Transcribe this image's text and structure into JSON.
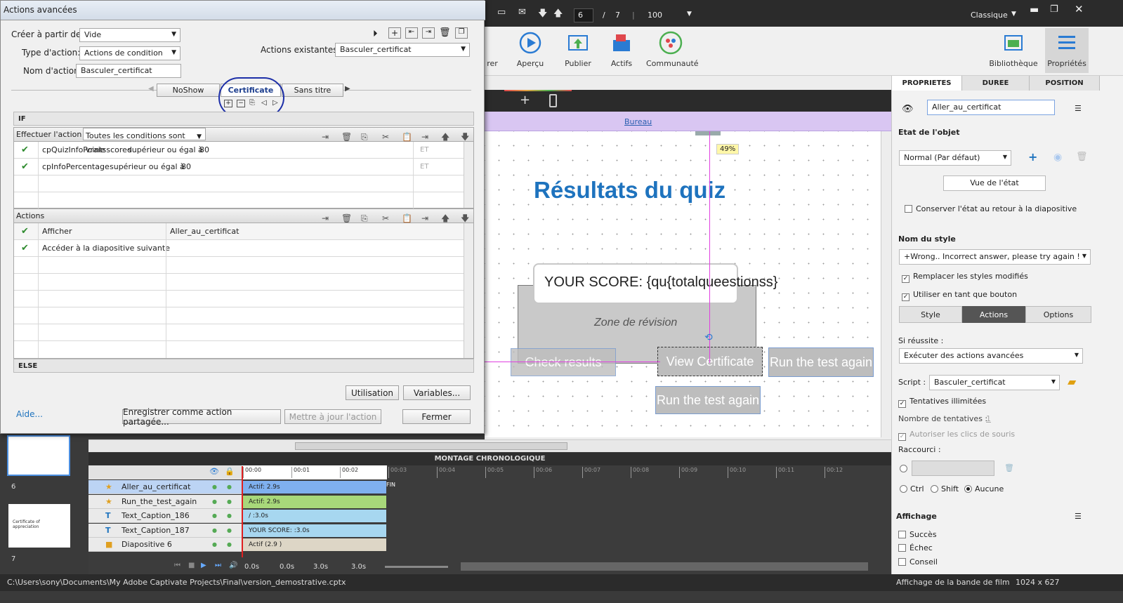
{
  "toolbar": {
    "slide_current": "6",
    "slide_sep": "/",
    "slide_total": "7",
    "zoom": "100",
    "workspace": "Classique"
  },
  "ribbon": {
    "buttons": [
      {
        "label": "rer",
        "icon": "record-icon"
      },
      {
        "label": "Aperçu",
        "icon": "play-icon"
      },
      {
        "label": "Publier",
        "icon": "publish-icon"
      },
      {
        "label": "Actifs",
        "icon": "assets-icon"
      },
      {
        "label": "Communauté",
        "icon": "community-icon"
      },
      {
        "label": "Bibliothèque",
        "icon": "library-icon"
      },
      {
        "label": "Propriétés",
        "icon": "properties-icon"
      }
    ]
  },
  "stage": {
    "breadcrumb": "Bureau",
    "progress_badge": "49%",
    "slide_title": "Résultats du quiz",
    "score_text": "YOUR   SCORE: {qu{totalqueestionss}",
    "review_zone": "Zone de révision",
    "btn_check": "Check results",
    "btn_view": "View Certificate",
    "btn_run1": "Run the test again",
    "btn_run2": "Run the test again"
  },
  "props": {
    "tabs": [
      "PROPRIETES",
      "DUREE",
      "POSITION"
    ],
    "object_name": "Aller_au_certificat",
    "state_title": "Etat de l'objet",
    "state_value": "Normal (Par défaut)",
    "state_view_btn": "Vue de l'état",
    "keep_state": "Conserver l'état au retour à la diapositive",
    "style_title": "Nom du style",
    "style_value": "+Wrong.. Incorrect answer, please try again !",
    "replace_styles": "Remplacer les styles modifiés",
    "use_as_button": "Utiliser en tant que bouton",
    "subtabs": [
      "Style",
      "Actions",
      "Options"
    ],
    "on_success": "Si réussite :",
    "on_success_value": "Exécuter des actions avancées",
    "script_label": "Script :",
    "script_value": "Basculer_certificat",
    "unlimited": "Tentatives illimitées",
    "attempts_label": "Nombre de tentatives :",
    "attempts_value": "1",
    "allow_clicks": "Autoriser les clics de souris",
    "shortcut_label": "Raccourci :",
    "ctrl": "Ctrl",
    "shift": "Shift",
    "none": "Aucune",
    "display_title": "Affichage",
    "success": "Succès",
    "fail": "Échec",
    "hint": "Conseil"
  },
  "timeline": {
    "title": "MONTAGE CHRONOLOGIQUE",
    "ticks": [
      "00:00",
      "00:01",
      "00:02",
      "00:03",
      "00:04",
      "00:05",
      "00:06",
      "00:07",
      "00:08",
      "00:09",
      "00:10",
      "00:11",
      "00:12"
    ],
    "rows": [
      {
        "name": "Aller_au_certificat",
        "bar": "Actif: 2.9s",
        "color": "#7fb0ef",
        "icon": "star-icon"
      },
      {
        "name": "Run_the_test_again",
        "bar": "Actif: 2.9s",
        "color": "#a8d87a",
        "icon": "star-icon"
      },
      {
        "name": "Text_Caption_186",
        "bar": "/ :3.0s",
        "color": "#a7d7f0",
        "icon": "text-caption-icon"
      },
      {
        "name": "Text_Caption_187",
        "bar": "YOUR   SCORE:                    :3.0s",
        "color": "#a7d7f0",
        "icon": "text-caption-icon"
      },
      {
        "name": "Diapositive 6",
        "bar": "Actif (2.9 )",
        "color": "#ddd6c6",
        "icon": "slide-icon"
      }
    ],
    "fin": "FIN",
    "t1": "0.0s",
    "t2": "0.0s",
    "t3": "3.0s",
    "t4": "3.0s"
  },
  "filmstrip": {
    "slide6": "6",
    "slide7": "7",
    "thumb7": "Certificate of appreciation"
  },
  "status": {
    "path": "C:\\Users\\sony\\Documents\\My Adobe Captivate Projects\\Final\\version_demostrative.cptx",
    "view": "Affichage de la bande de film",
    "size": "1024 x 627"
  },
  "dialog": {
    "title": "Actions avancées",
    "create_from_label": "Créer à partir de:",
    "create_from_value": "Vide",
    "action_type_label": "Type d'action:",
    "action_type_value": "Actions de condition",
    "action_name_label": "Nom d'action:",
    "action_name_value": "Basculer_certificat",
    "existing_label": "Actions existantes:",
    "existing_value": "Basculer_certificat",
    "tabs": [
      "NoShow",
      "Certificate",
      "Sans titre"
    ],
    "if_label": "IF",
    "perform_label": "Effectuer l'action si:",
    "perform_value": "Toutes les conditions sont vraie",
    "conditions": [
      {
        "var": "cpQuizInfoPointsscored",
        "op": "supérieur ou égal à",
        "val": "80",
        "logic": "ET"
      },
      {
        "var": "cpInfoPercentage",
        "op": "supérieur ou égal à",
        "val": "80",
        "logic": "ET"
      }
    ],
    "actions_label": "Actions",
    "actions": [
      {
        "name": "Afficher",
        "target": "Aller_au_certificat"
      },
      {
        "name": "Accéder à la diapositive suivante",
        "target": ""
      }
    ],
    "else_label": "ELSE",
    "btn_usage": "Utilisation",
    "btn_vars": "Variables...",
    "help": "Aide...",
    "btn_save_shared": "Enregistrer comme action partagée...",
    "btn_update": "Mettre à jour l'action",
    "btn_close": "Fermer"
  }
}
